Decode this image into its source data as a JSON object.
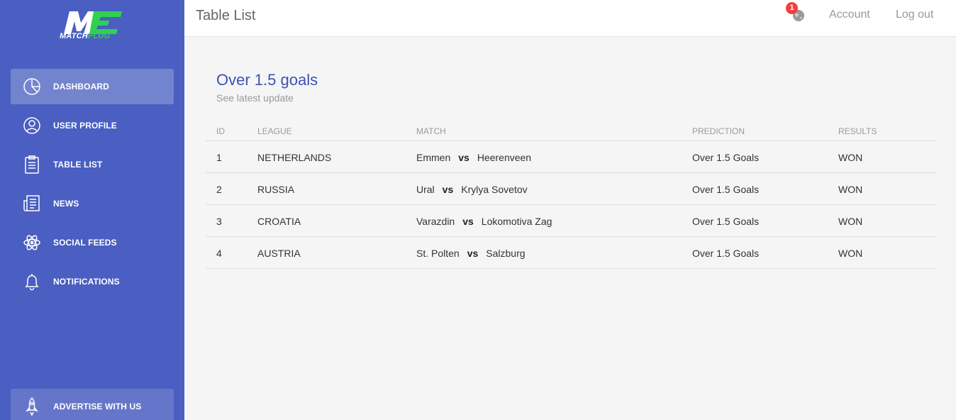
{
  "brand": {
    "logo_mark": "ME",
    "logo_text_a": "MATCH",
    "logo_text_b": "PLUG",
    "accent_color": "#2fd14f",
    "sidebar_color": "#4a5fc1"
  },
  "sidebar": {
    "items": [
      {
        "label": "DASHBOARD",
        "icon": "pie-chart-icon",
        "active": true
      },
      {
        "label": "USER PROFILE",
        "icon": "user-icon",
        "active": false
      },
      {
        "label": "TABLE LIST",
        "icon": "clipboard-icon",
        "active": false
      },
      {
        "label": "NEWS",
        "icon": "newspaper-icon",
        "active": false
      },
      {
        "label": "SOCIAL FEEDS",
        "icon": "atom-icon",
        "active": false
      },
      {
        "label": "NOTIFICATIONS",
        "icon": "bell-icon",
        "active": false
      }
    ],
    "bottom": {
      "label": "ADVERTISE WITH US",
      "icon": "rocket-icon"
    }
  },
  "topbar": {
    "title": "Table List",
    "notification_count": "1",
    "account_label": "Account",
    "logout_label": "Log out"
  },
  "card": {
    "title": "Over 1.5 goals",
    "subtitle": "See latest update"
  },
  "table": {
    "headers": [
      "ID",
      "LEAGUE",
      "MATCH",
      "PREDICTION",
      "RESULTS"
    ],
    "vs_label": "vs",
    "rows": [
      {
        "id": "1",
        "league": "NETHERLANDS",
        "home": "Emmen",
        "away": "Heerenveen",
        "prediction": "Over 1.5 Goals",
        "result": "WON"
      },
      {
        "id": "2",
        "league": "RUSSIA",
        "home": "Ural",
        "away": "Krylya Sovetov",
        "prediction": "Over 1.5 Goals",
        "result": "WON"
      },
      {
        "id": "3",
        "league": "CROATIA",
        "home": "Varazdin",
        "away": "Lokomotiva Zag",
        "prediction": "Over 1.5 Goals",
        "result": "WON"
      },
      {
        "id": "4",
        "league": "AUSTRIA",
        "home": "St. Polten",
        "away": "Salzburg",
        "prediction": "Over 1.5 Goals",
        "result": "WON"
      }
    ]
  }
}
